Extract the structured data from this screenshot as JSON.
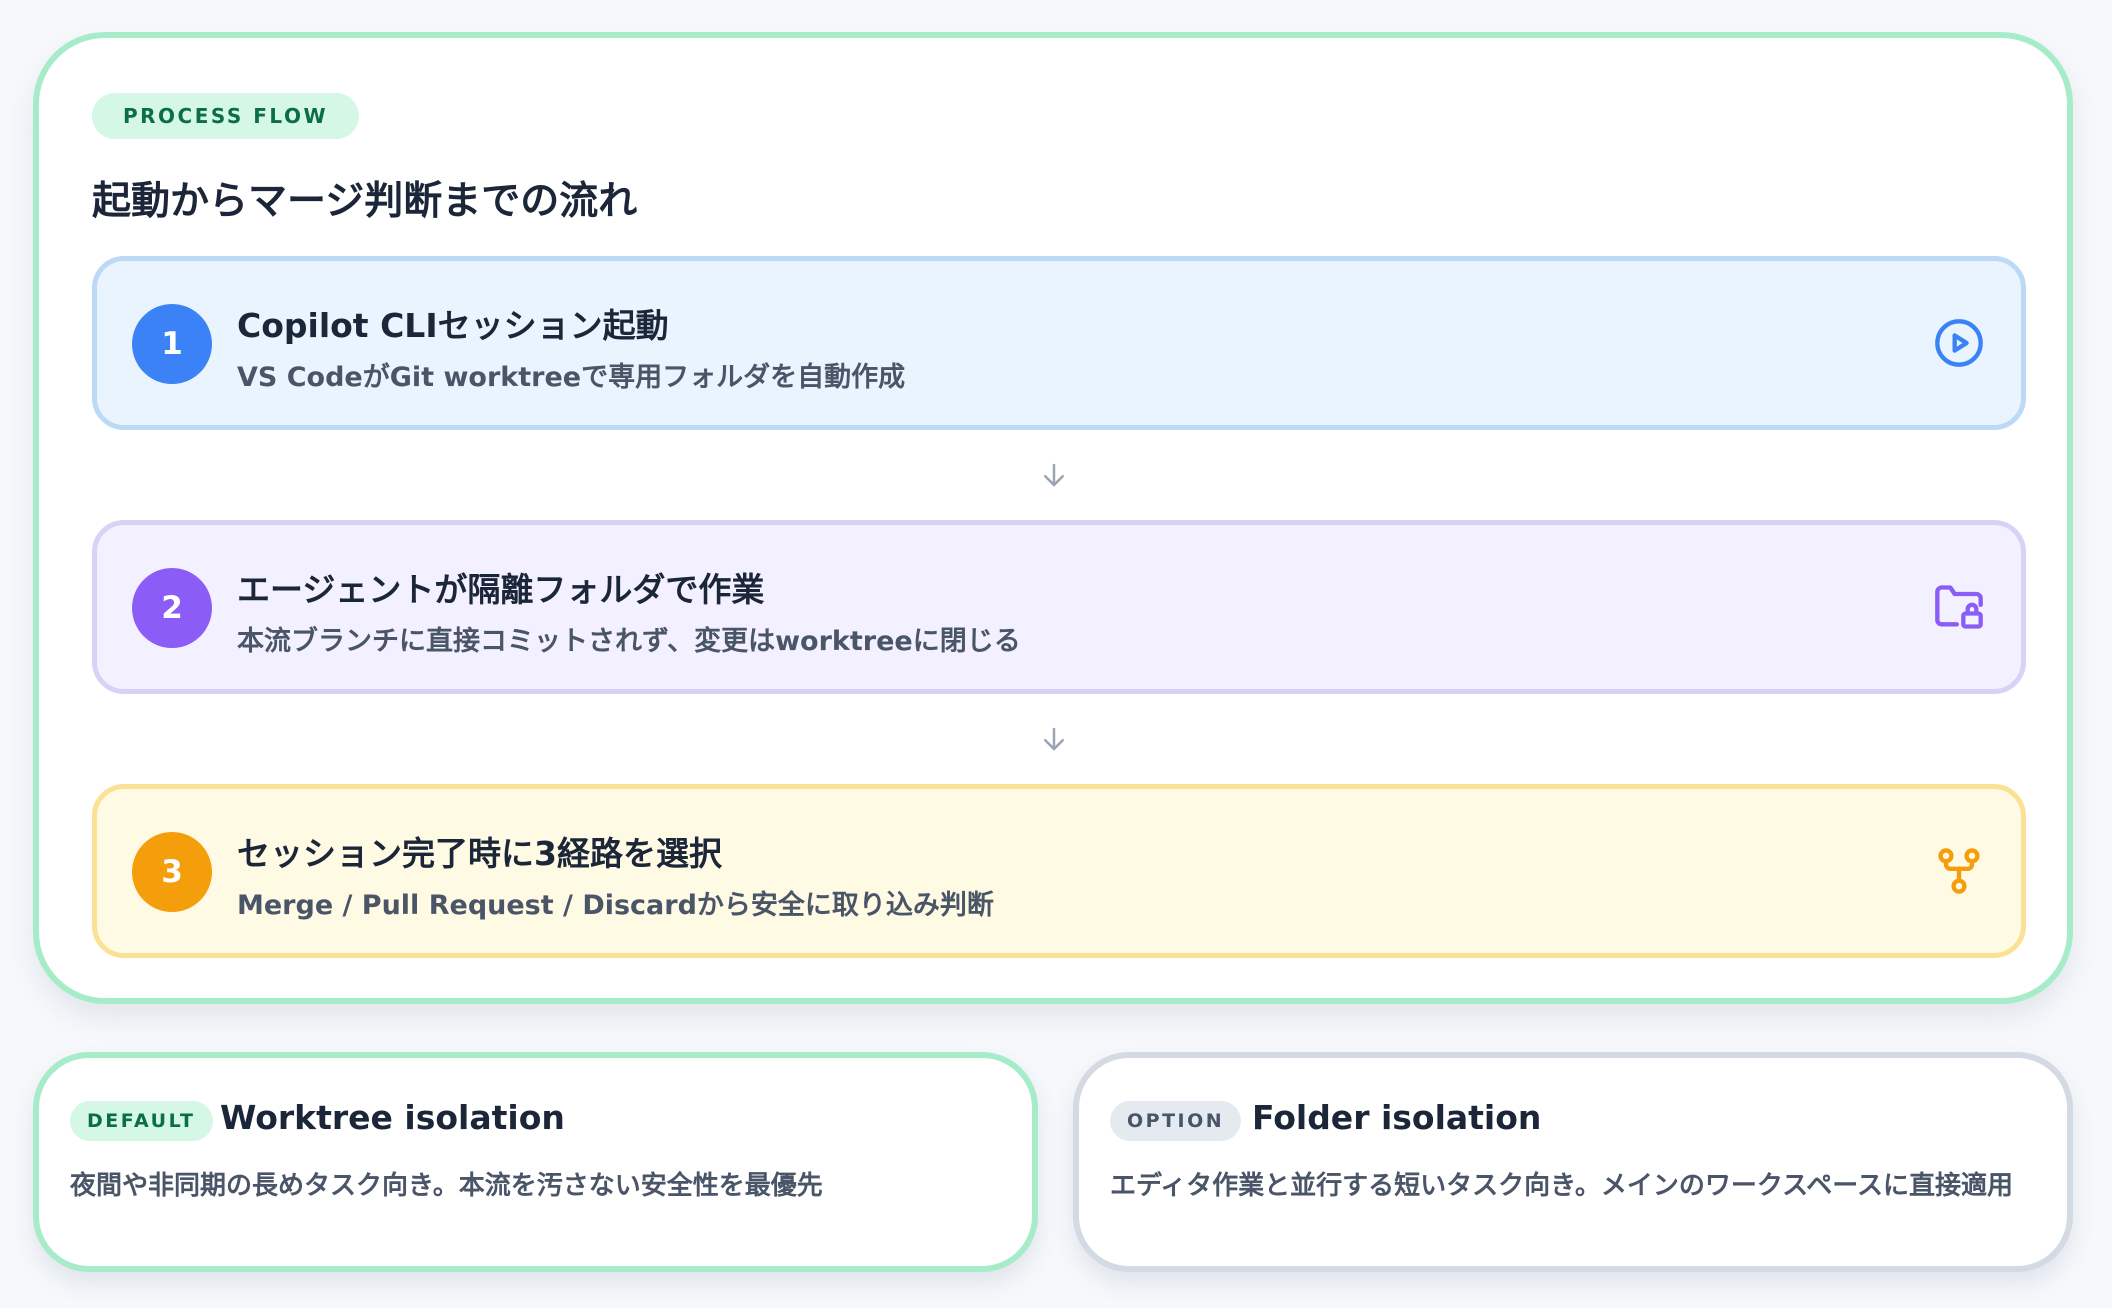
{
  "flow": {
    "eyebrow": "PROCESS FLOW",
    "title": "起動からマージ判断までの流れ",
    "steps": [
      {
        "number": "1",
        "title": "Copilot CLIセッション起動",
        "description": "VS CodeがGit worktreeで専用フォルダを自動作成",
        "icon": "play-circle-icon",
        "accent": "#3b82f6"
      },
      {
        "number": "2",
        "title": "エージェントが隔離フォルダで作業",
        "description": "本流ブランチに直接コミットされず、変更はworktreeに閉じる",
        "icon": "folder-lock-icon",
        "accent": "#8b5cf6"
      },
      {
        "number": "3",
        "title": "セッション完了時に3経路を選択",
        "description": "Merge / Pull Request / Discardから安全に取り込み判断",
        "icon": "git-fork-icon",
        "accent": "#f59e0b"
      }
    ]
  },
  "modes": {
    "default": {
      "badge": "DEFAULT",
      "title": "Worktree isolation",
      "description": "夜間や非同期の長めタスク向き。本流を汚さない安全性を最優先"
    },
    "option": {
      "badge": "OPTION",
      "title": "Folder isolation",
      "description": "エディタ作業と並行する短いタスク向き。メインのワークスペースに直接適用"
    }
  },
  "colors": {
    "accent_green": "#a7ecc9",
    "step1_bg": "#eaf4ff",
    "step2_bg": "#f3f1ff",
    "step3_bg": "#fffae4"
  }
}
